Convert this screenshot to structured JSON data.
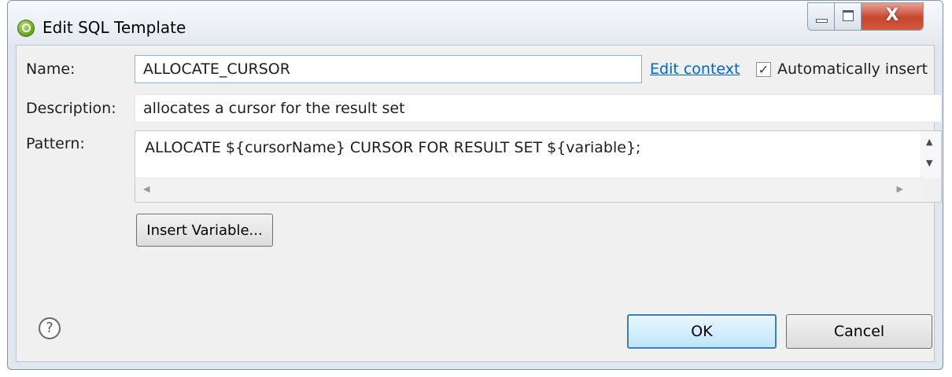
{
  "window": {
    "title": "Edit SQL Template",
    "app_icon": "eclipse-sql-icon",
    "caption_close": "X"
  },
  "form": {
    "name_label": "Name:",
    "name_value": "ALLOCATE_CURSOR",
    "edit_context_link": "Edit context",
    "auto_insert_checked": true,
    "auto_insert_mark": "✓",
    "auto_insert_label": "Automatically insert",
    "description_label": "Description:",
    "description_value": "allocates a cursor for the result set",
    "pattern_label": "Pattern:",
    "pattern_value": "ALLOCATE ${cursorName} CURSOR FOR RESULT SET ${variable};"
  },
  "buttons": {
    "insert_variable": "Insert Variable...",
    "ok": "OK",
    "cancel": "Cancel",
    "help": "?"
  },
  "colors": {
    "link": "#0066cc",
    "close_button": "#c7452b",
    "default_button_border": "#3c7fb1"
  }
}
